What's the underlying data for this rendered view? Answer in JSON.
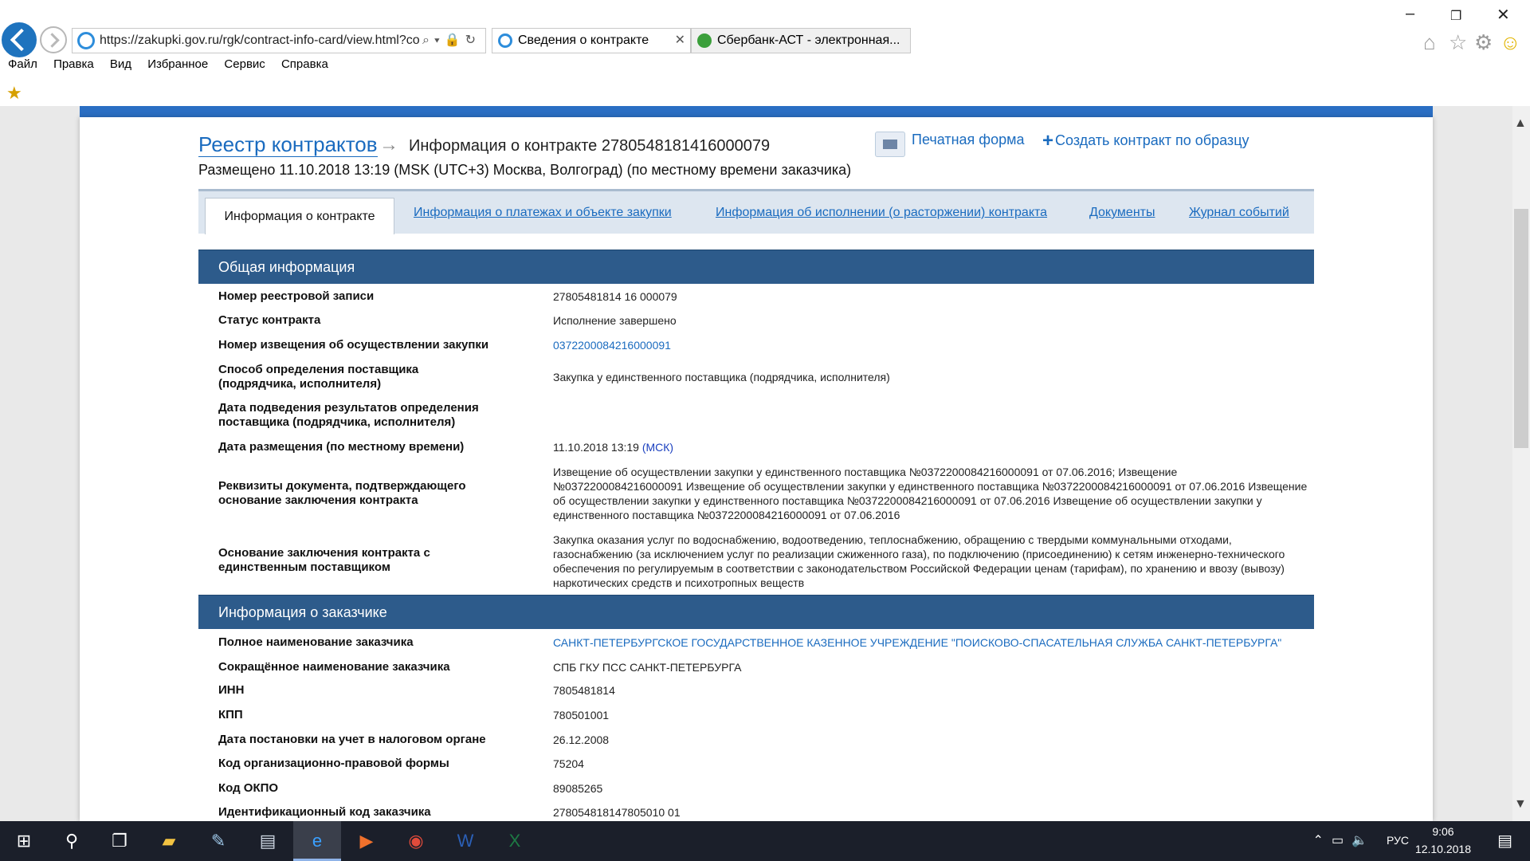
{
  "browser": {
    "url": "https://zakupki.gov.ru/rgk/contract-info-card/view.html?co",
    "tabs": [
      {
        "title": "Сведения о контракте"
      },
      {
        "title": "Сбербанк-АСТ - электронная..."
      }
    ],
    "menu": [
      "Файл",
      "Правка",
      "Вид",
      "Избранное",
      "Сервис",
      "Справка"
    ]
  },
  "page": {
    "breadcrumb_link": "Реестр контрактов",
    "breadcrumb_current": "Информация о контракте 2780548181416000079",
    "placed": "Размещено 11.10.2018 13:19 (MSK (UTC+3) Москва, Волгоград) (по местному времени заказчика)",
    "print_form": "Печатная форма",
    "create_by_sample": "Создать контракт по образцу",
    "tabs": [
      "Информация о контракте",
      "Информация о платежах и объекте закупки",
      "Информация об исполнении (о расторжении) контракта",
      "Документы",
      "Журнал событий"
    ],
    "general": {
      "title": "Общая информация",
      "rows": [
        {
          "label": "Номер реестровой записи",
          "value": "27805481814 16 000079"
        },
        {
          "label": "Статус контракта",
          "value": "Исполнение завершено"
        },
        {
          "label": "Номер извещения об осуществлении закупки",
          "value": "0372200084216000091"
        },
        {
          "label": "Способ определения поставщика (подрядчика, исполнителя)",
          "value": "Закупка у единственного поставщика (подрядчика, исполнителя)"
        },
        {
          "label": "Дата подведения результатов определения поставщика (подрядчика, исполнителя)",
          "value": ""
        },
        {
          "label": "Дата размещения (по местному времени)",
          "value": "11.10.2018 13:19",
          "tz": "(МСК)"
        },
        {
          "label": "Реквизиты документа, подтверждающего основание заключения контракта",
          "value": "Извещение об осуществлении закупки у единственного поставщика №0372200084216000091 от 07.06.2016; Извещение №0372200084216000091 Извещение об осуществлении закупки у единственного поставщика №0372200084216000091 от 07.06.2016 Извещение об осуществлении закупки у единственного поставщика №0372200084216000091 от 07.06.2016 Извещение об осуществлении закупки у единственного поставщика №0372200084216000091 от 07.06.2016"
        },
        {
          "label": "Основание заключения контракта с единственным поставщиком",
          "value": "Закупка оказания услуг по водоснабжению, водоотведению, теплоснабжению, обращению с твердыми коммунальными отходами, газоснабжению (за исключением услуг по реализации сжиженного газа), по подключению (присоединению) к сетям инженерно-технического обеспечения по регулируемым в соответствии с законодательством Российской Федерации ценам (тарифам), по хранению и ввозу (вывозу) наркотических средств и психотропных веществ"
        }
      ]
    },
    "customer": {
      "title": "Информация о заказчике",
      "rows": [
        {
          "label": "Полное наименование заказчика",
          "value": "САНКТ-ПЕТЕРБУРГСКОЕ ГОСУДАРСТВЕННОЕ КАЗЕННОЕ УЧРЕЖДЕНИЕ \"ПОИСКОВО-СПАСАТЕЛЬНАЯ СЛУЖБА САНКТ-ПЕТЕРБУРГА\""
        },
        {
          "label": "Сокращённое наименование заказчика",
          "value": "СПБ ГКУ ПСС САНКТ-ПЕТЕРБУРГА"
        },
        {
          "label": "ИНН",
          "value": "7805481814"
        },
        {
          "label": "КПП",
          "value": "780501001"
        },
        {
          "label": "Дата постановки на учет в налоговом органе",
          "value": "26.12.2008"
        },
        {
          "label": "Код организационно-правовой формы",
          "value": "75204"
        },
        {
          "label": "Код ОКПО",
          "value": "89085265"
        },
        {
          "label": "Идентификационный код заказчика",
          "value": "278054818147805010 01"
        }
      ]
    }
  },
  "taskbar": {
    "lang": "РУС",
    "time": "9:06",
    "date": "12.10.2018"
  }
}
